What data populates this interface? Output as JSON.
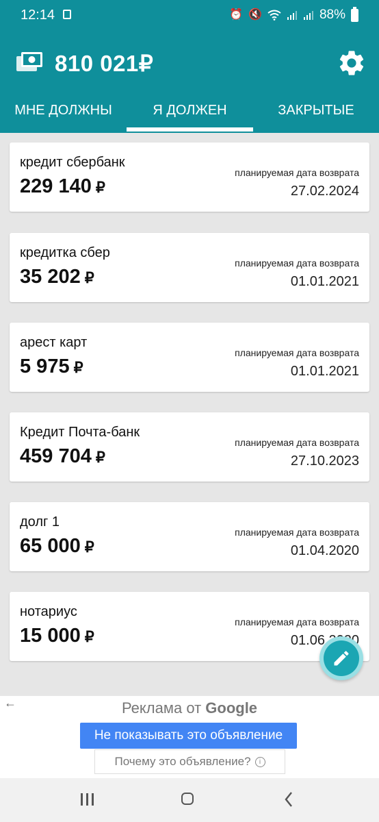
{
  "status_bar": {
    "time": "12:14",
    "battery": "88%"
  },
  "header": {
    "balance": "810 021₽"
  },
  "tabs": [
    {
      "label": "МНЕ ДОЛЖНЫ",
      "active": false
    },
    {
      "label": "Я ДОЛЖЕН",
      "active": true
    },
    {
      "label": "ЗАКРЫТЫЕ",
      "active": false
    }
  ],
  "date_label": "планируемая дата возврата",
  "currency": "₽",
  "debts": [
    {
      "name": "кредит сбербанк",
      "amount": "229 140",
      "date": "27.02.2024"
    },
    {
      "name": "кредитка сбер",
      "amount": "35 202",
      "date": "01.01.2021"
    },
    {
      "name": "арест карт",
      "amount": "5 975",
      "date": "01.01.2021"
    },
    {
      "name": "Кредит Почта-банк",
      "amount": "459 704",
      "date": "27.10.2023"
    },
    {
      "name": "долг 1",
      "amount": "65 000",
      "date": "01.04.2020"
    },
    {
      "name": "нотариус",
      "amount": "15 000",
      "date": "01.06.2020"
    }
  ],
  "ad": {
    "title_prefix": "Реклама от",
    "title_brand": "Google",
    "hide_button": "Не показывать это объявление",
    "why_button": "Почему это объявление?"
  },
  "colors": {
    "primary": "#0f8f9b",
    "fab": "#1ba6b3",
    "ad_button": "#4285f4"
  }
}
